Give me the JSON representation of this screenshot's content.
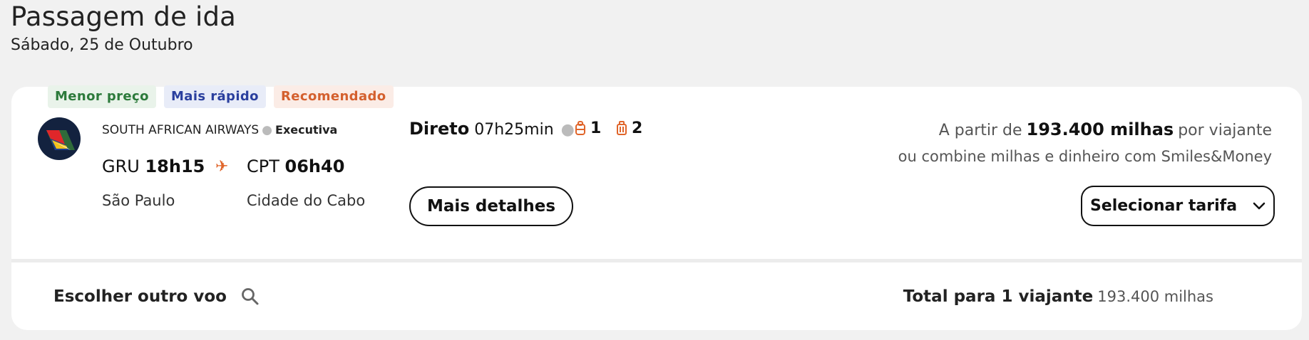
{
  "header": {
    "title": "Passagem de ida",
    "date": "Sábado, 25 de Outubro"
  },
  "badges": {
    "lowest_price": "Menor preço",
    "fastest": "Mais rápido",
    "recommended": "Recomendado"
  },
  "flight": {
    "airline": "SOUTH AFRICAN AIRWAYS",
    "cabin": "Executiva",
    "logo_icon": "south-african-airways-logo",
    "origin_code": "GRU",
    "origin_time": "18h15",
    "origin_city": "São Paulo",
    "dest_code": "CPT",
    "dest_time": "06h40",
    "dest_city": "Cidade do Cabo",
    "stops": "Direto",
    "duration": "07h25min",
    "carry_on_count": "1",
    "checked_bag_count": "2",
    "details_label": "Mais detalhes"
  },
  "price": {
    "prefix": "A partir de",
    "amount": "193.400 milhas",
    "suffix": "por viajante",
    "combine_text": "ou combine milhas e dinheiro com Smiles&Money",
    "select_label": "Selecionar tarifa"
  },
  "footer": {
    "choose_other": "Escolher outro voo",
    "total_label": "Total para 1 viajante",
    "total_value": "193.400 milhas"
  },
  "colors": {
    "accent_orange": "#e0652a",
    "badge_green": "#2c7a3b",
    "badge_blue": "#2a3f9e",
    "badge_orange": "#d4602e"
  }
}
